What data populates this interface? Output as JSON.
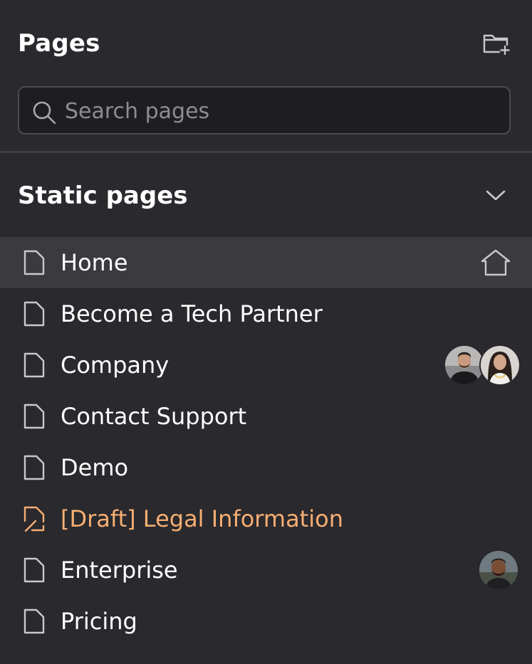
{
  "header": {
    "title": "Pages",
    "new_folder_icon": "folder-plus-icon"
  },
  "search": {
    "placeholder": "Search pages",
    "value": "",
    "icon": "search-icon"
  },
  "section": {
    "title": "Static pages",
    "expanded": true,
    "toggle_icon": "chevron-down-icon"
  },
  "pages": [
    {
      "label": "Home",
      "icon": "document-icon",
      "active": true,
      "is_home": true,
      "draft": false,
      "collaborators": 0
    },
    {
      "label": "Become a Tech Partner",
      "icon": "document-icon",
      "active": false,
      "is_home": false,
      "draft": false,
      "collaborators": 0
    },
    {
      "label": "Company",
      "icon": "document-icon",
      "active": false,
      "is_home": false,
      "draft": false,
      "collaborators": 2
    },
    {
      "label": "Contact Support",
      "icon": "document-icon",
      "active": false,
      "is_home": false,
      "draft": false,
      "collaborators": 0
    },
    {
      "label": "Demo",
      "icon": "document-icon",
      "active": false,
      "is_home": false,
      "draft": false,
      "collaborators": 0
    },
    {
      "label": "[Draft] Legal Information",
      "icon": "draft-document-icon",
      "active": false,
      "is_home": false,
      "draft": true,
      "collaborators": 0
    },
    {
      "label": "Enterprise",
      "icon": "document-icon",
      "active": false,
      "is_home": false,
      "draft": false,
      "collaborators": 1
    },
    {
      "label": "Pricing",
      "icon": "document-icon",
      "active": false,
      "is_home": false,
      "draft": false,
      "collaborators": 0
    }
  ],
  "colors": {
    "background": "#2a292d",
    "active_row": "#3b3a3f",
    "draft_accent": "#f6ae72",
    "text": "#ffffff",
    "muted": "#8d8c92"
  }
}
